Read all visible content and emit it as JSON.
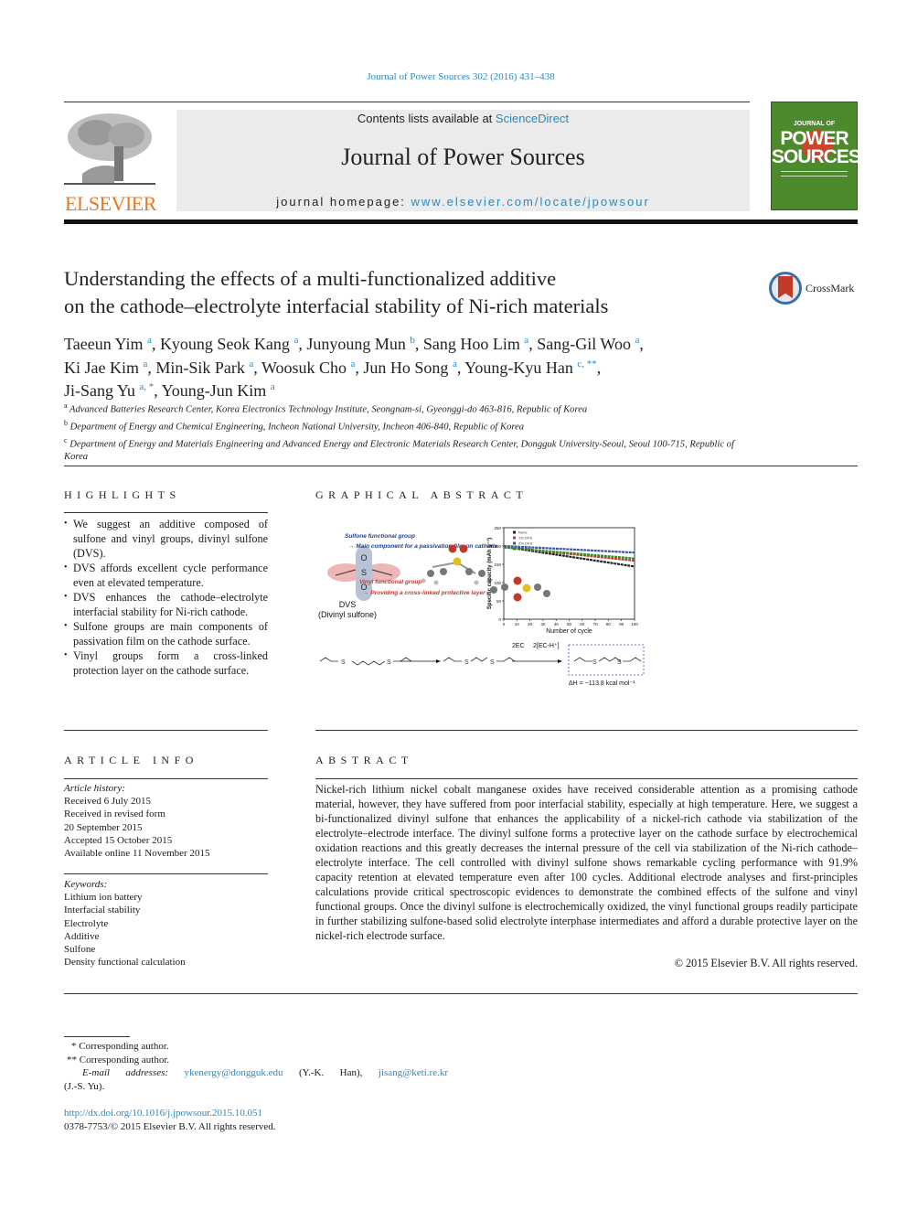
{
  "header": {
    "citation": "Journal of Power Sources 302 (2016) 431–438",
    "contents_prefix": "Contents lists available at ",
    "contents_link": "ScienceDirect",
    "journal_title": "Journal of Power Sources",
    "homepage_prefix": "journal homepage: ",
    "homepage_link": "www.elsevier.com/locate/jpowsour",
    "publisher_logo": "ELSEVIER",
    "cover": {
      "line1": "JOURNAL OF",
      "line2": "POWER",
      "line3": "SOURCES"
    },
    "crossmark_label": "CrossMark"
  },
  "article": {
    "title_line1": "Understanding the effects of a multi-functionalized additive",
    "title_line2": "on the cathode–electrolyte interfacial stability of Ni-rich materials",
    "authors": [
      {
        "name": "Taeeun Yim",
        "sup": "a",
        "sep": ", "
      },
      {
        "name": "Kyoung Seok Kang",
        "sup": "a",
        "sep": ", "
      },
      {
        "name": "Junyoung Mun",
        "sup": "b",
        "sep": ", "
      },
      {
        "name": "Sang Hoo Lim",
        "sup": "a",
        "sep": ", "
      },
      {
        "name": "Sang-Gil Woo",
        "sup": "a",
        "sep": ","
      },
      {
        "name": "Ki Jae Kim",
        "sup": "a",
        "sep": ", "
      },
      {
        "name": "Min-Sik Park",
        "sup": "a",
        "sep": ", "
      },
      {
        "name": "Woosuk Cho",
        "sup": "a",
        "sep": ", "
      },
      {
        "name": "Jun Ho Song",
        "sup": "a",
        "sep": ", "
      },
      {
        "name": "Young-Kyu Han",
        "sup": "c, **",
        "sep": ","
      },
      {
        "name": "Ji-Sang Yu",
        "sup": "a, *",
        "sep": ", "
      },
      {
        "name": "Young-Jun Kim",
        "sup": "a",
        "sep": ""
      }
    ],
    "affiliations": [
      {
        "key": "a",
        "text": "Advanced Batteries Research Center, Korea Electronics Technology Institute, Seongnam-si, Gyeonggi-do 463-816, Republic of Korea"
      },
      {
        "key": "b",
        "text": "Department of Energy and Chemical Engineering, Incheon National University, Incheon 406-840, Republic of Korea"
      },
      {
        "key": "c",
        "text": "Department of Energy and Materials Engineering and Advanced Energy and Electronic Materials Research Center, Dongguk University-Seoul, Seoul 100-715, Republic of Korea"
      }
    ]
  },
  "highlights": {
    "heading": "HIGHLIGHTS",
    "items": [
      "We suggest an additive composed of sulfone and vinyl groups, divinyl sulfone (DVS).",
      "DVS affords excellent cycle performance even at elevated temperature.",
      "DVS enhances the cathode–electrolyte interfacial stability for Ni-rich cathode.",
      "Sulfone groups are main components of passivation film on the cathode surface.",
      "Vinyl groups form a cross-linked protection layer on the cathode surface."
    ]
  },
  "graphical_abstract": {
    "heading": "GRAPHICAL ABSTRACT",
    "sulfone_label": "Sulfone functional group",
    "sulfone_desc": "→ Main component for a passivation film on cathode",
    "vinyl_label": "Vinyl functional group",
    "vinyl_desc": "→ Providing a cross-linked protective layer",
    "molecule_abbr": "DVS",
    "molecule_name": "(Divinyl sulfone)",
    "reagent_left": "2EC",
    "reagent_right": "2[EC-H⁺]",
    "enthalpy": "ΔH = −113.8 kcal mol⁻¹",
    "colors": {
      "none": "#222222",
      "red": "#c0392b",
      "blue": "#3557a8",
      "green": "#3a8a2a",
      "sulfone_text": "#1f3f8f",
      "vinyl_text": "#c0392b"
    }
  },
  "chart_data": {
    "type": "line",
    "title": "",
    "xlabel": "Number of cycle",
    "ylabel": "Specific capacity (mAh g⁻¹)",
    "xlim": [
      0,
      100
    ],
    "ylim": [
      0,
      250
    ],
    "xticks": [
      0,
      10,
      20,
      30,
      40,
      50,
      60,
      70,
      80,
      90,
      100
    ],
    "yticks": [
      0,
      50,
      100,
      150,
      200,
      250
    ],
    "legend_position": "top-left",
    "x": [
      0,
      100
    ],
    "series": [
      {
        "name": "None",
        "color": "#222222",
        "values": [
          198,
          144
        ]
      },
      {
        "name": "1% DVS",
        "color": "#c0392b",
        "values": [
          197,
          160
        ]
      },
      {
        "name": "2% DVS",
        "color": "#3557a8",
        "values": [
          200,
          182
        ]
      },
      {
        "name": "3% DVS",
        "color": "#3a8a2a",
        "values": [
          196,
          166
        ]
      }
    ]
  },
  "article_info": {
    "heading": "ARTICLE INFO",
    "history_label": "Article history:",
    "history": [
      "Received 6 July 2015",
      "Received in revised form",
      "20 September 2015",
      "Accepted 15 October 2015",
      "Available online 11 November 2015"
    ],
    "keywords_label": "Keywords:",
    "keywords": [
      "Lithium ion battery",
      "Interfacial stability",
      "Electrolyte",
      "Additive",
      "Sulfone",
      "Density functional calculation"
    ]
  },
  "abstract": {
    "heading": "ABSTRACT",
    "text": "Nickel-rich lithium nickel cobalt manganese oxides have received considerable attention as a promising cathode material, however, they have suffered from poor interfacial stability, especially at high temperature. Here, we suggest a bi-functionalized divinyl sulfone that enhances the applicability of a nickel-rich cathode via stabilization of the electrolyte–electrode interface. The divinyl sulfone forms a protective layer on the cathode surface by electrochemical oxidation reactions and this greatly decreases the internal pressure of the cell via stabilization of the Ni-rich cathode–electrolyte interface. The cell controlled with divinyl sulfone shows remarkable cycling performance with 91.9% capacity retention at elevated temperature even after 100 cycles. Additional electrode analyses and first-principles calculations provide critical spectroscopic evidences to demonstrate the combined effects of the sulfone and vinyl functional groups. Once the divinyl sulfone is electrochemically oxidized, the vinyl functional groups readily participate in further stabilizing sulfone-based solid electrolyte interphase intermediates and afford a durable protective layer on the nickel-rich electrode surface.",
    "copyright": "© 2015 Elsevier B.V. All rights reserved."
  },
  "footnotes": {
    "corr1": "* Corresponding author.",
    "corr2": "** Corresponding author.",
    "email_label": "E-mail addresses:",
    "email1": "ykenergy@dongguk.edu",
    "email1_owner": "(Y.-K. Han),",
    "email2": "jisang@keti.re.kr",
    "email2_owner": "(J.-S. Yu).",
    "doi": "http://dx.doi.org/10.1016/j.jpowsour.2015.10.051",
    "issn": "0378-7753/© 2015 Elsevier B.V. All rights reserved."
  }
}
